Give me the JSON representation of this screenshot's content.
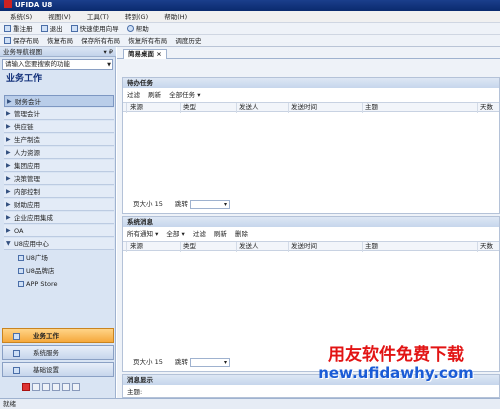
{
  "window": {
    "title": "UFIDA U8"
  },
  "menu": [
    "系统(S)",
    "视图(V)",
    "工具(T)",
    "转到(G)",
    "帮助(H)"
  ],
  "toolbar1": [
    "重注册",
    "退出",
    "快速使用向导",
    "帮助"
  ],
  "toolbar2": [
    "保存布局",
    "恢复布局",
    "保存所有布局",
    "恢复所有布局",
    "调度历史"
  ],
  "left_panel": {
    "header": "业务导航视图",
    "pin": "▾ ₽",
    "search_placeholder": "请输入您要搜索的功能",
    "title": "业务工作",
    "nav_items": [
      "财务会计",
      "管理会计",
      "供应链",
      "生产制造",
      "人力资源",
      "集团应用",
      "决策管理",
      "内部控制",
      "财助应用",
      "企业应用集成",
      "OA",
      "U8应用中心"
    ],
    "sub_items": [
      "U8广场",
      "U8品牌店",
      "APP Store"
    ],
    "buttons": [
      "业务工作",
      "系统服务",
      "基础设置"
    ]
  },
  "tab": {
    "label": "简易桌面",
    "close": "×"
  },
  "todo": {
    "title": "待办任务",
    "tools": [
      "过滤",
      "刷新",
      "全部任务 ▾"
    ],
    "columns": [
      "来源",
      "类型",
      "发送人",
      "发送时间",
      "主题",
      "天数"
    ],
    "pager": {
      "page_size_label": "页大小",
      "page_size": "15",
      "jump_label": "跳转"
    }
  },
  "messages": {
    "title": "系统消息",
    "tools": [
      "所有通知 ▾",
      "全部 ▾",
      "过滤",
      "刷新",
      "删除"
    ],
    "columns": [
      "来源",
      "类型",
      "发送人",
      "发送时间",
      "主题",
      "天数"
    ],
    "pager": {
      "page_size_label": "页大小",
      "page_size": "15",
      "jump_label": "跳转"
    }
  },
  "message_display": {
    "title": "消息显示",
    "subject_label": "主题:"
  },
  "status": {
    "text": "就绪"
  },
  "watermark": {
    "line1": "用友软件免费下载",
    "line2": "new.ufidawhy.com"
  }
}
